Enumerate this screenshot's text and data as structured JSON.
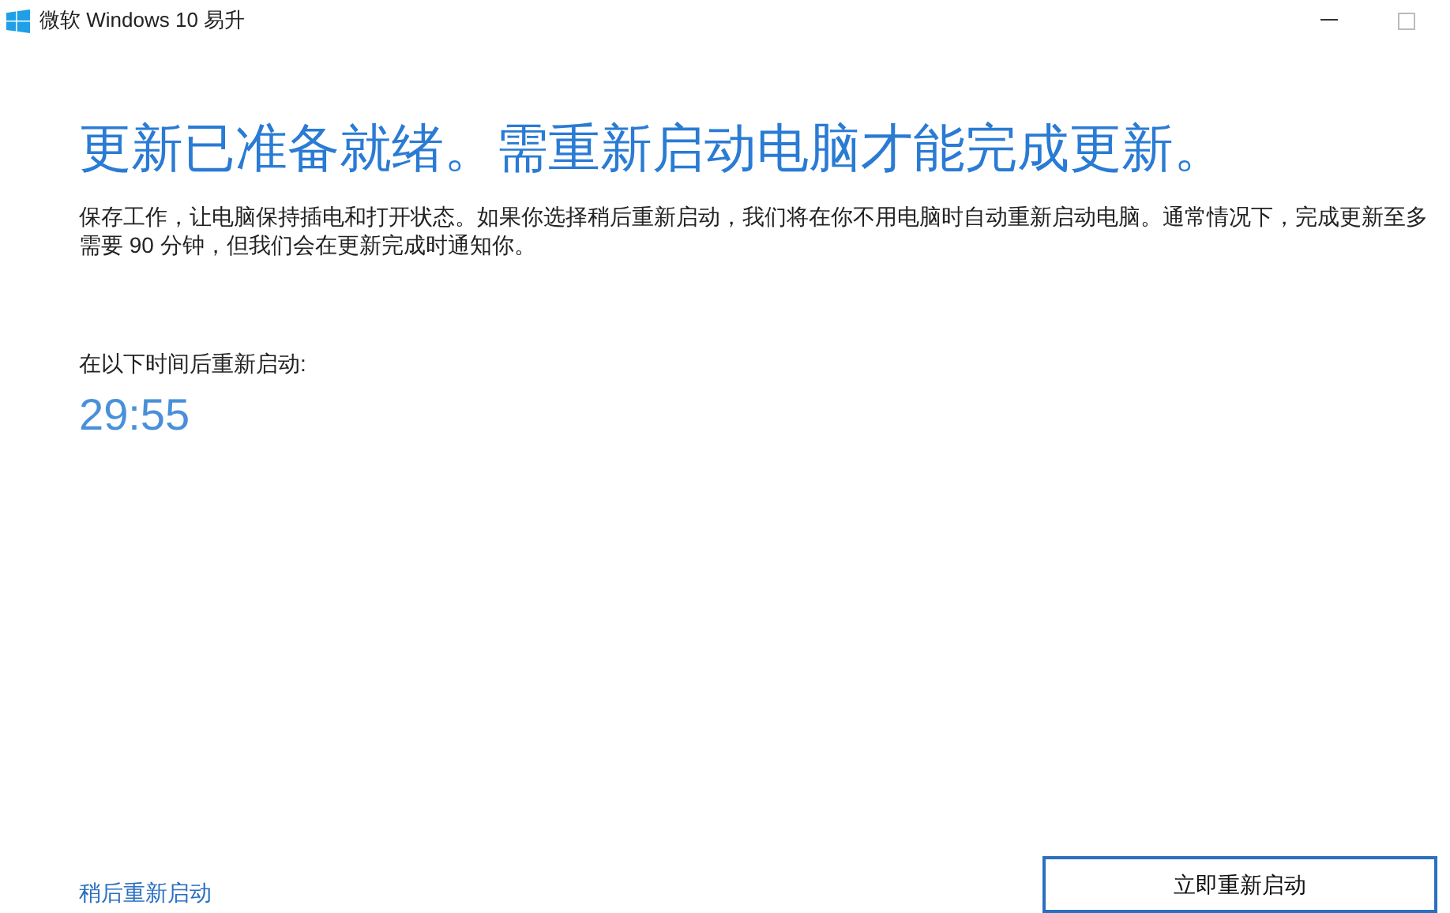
{
  "window": {
    "title": "微软 Windows 10 易升"
  },
  "heading": "更新已准备就绪。需重新启动电脑才能完成更新。",
  "description": "保存工作，让电脑保持插电和打开状态。如果你选择稍后重新启动，我们将在你不用电脑时自动重新启动电脑。通常情况下，完成更新至多需要 90 分钟，但我们会在更新完成时通知你。",
  "countdown": {
    "label": "在以下时间后重新启动:",
    "time": "29:55"
  },
  "restart_later_link": "稍后重新启动",
  "restart_now_button": "立即重新启动"
}
